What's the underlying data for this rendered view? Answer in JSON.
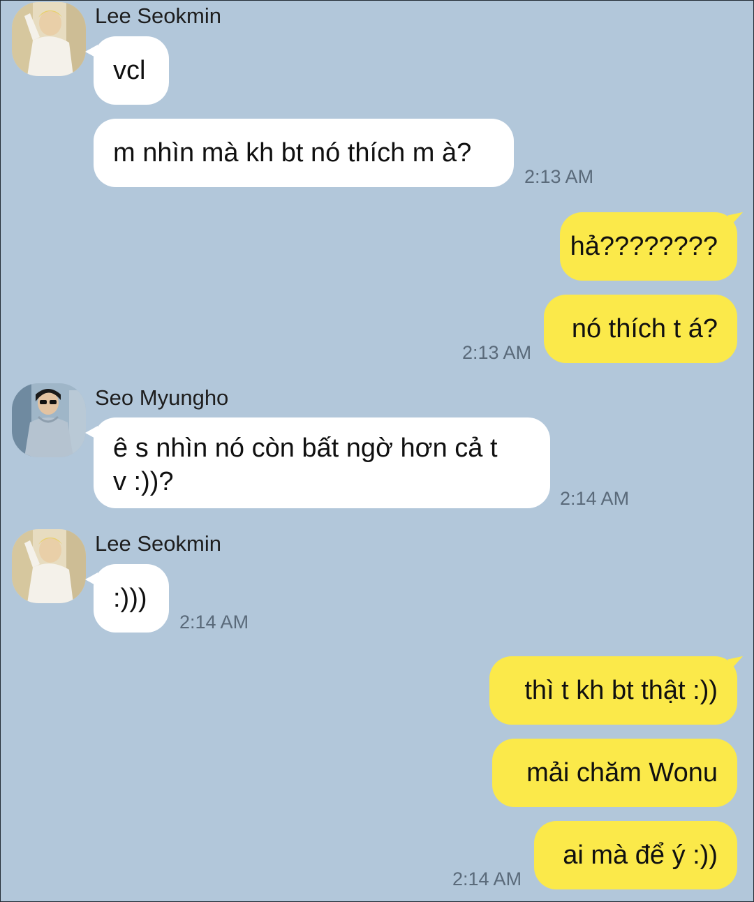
{
  "theme": {
    "background": "#b2c7da",
    "incoming_bubble": "#ffffff",
    "outgoing_bubble": "#fbe94a"
  },
  "conversation": {
    "group1": {
      "sender": "Lee Seokmin",
      "avatar_icon": "profile-photo-lee-seokmin",
      "messages": [
        "vcl",
        "m nhìn mà kh bt nó thích m à?"
      ],
      "time": "2:13 AM"
    },
    "me1": {
      "messages": [
        "hả????????",
        "nó thích t á?"
      ],
      "time": "2:13 AM"
    },
    "group2": {
      "sender": "Seo Myungho",
      "avatar_icon": "profile-photo-seo-myungho",
      "messages": [
        "ê s nhìn nó còn bất ngờ hơn cả t\nv :))?"
      ],
      "time": "2:14 AM"
    },
    "group3": {
      "sender": "Lee Seokmin",
      "avatar_icon": "profile-photo-lee-seokmin",
      "messages": [
        ":)))"
      ],
      "time": "2:14 AM"
    },
    "me2": {
      "messages": [
        "thì t kh bt thật :))",
        "mải chăm Wonu",
        "ai mà để ý :))"
      ],
      "time": "2:14 AM"
    }
  }
}
